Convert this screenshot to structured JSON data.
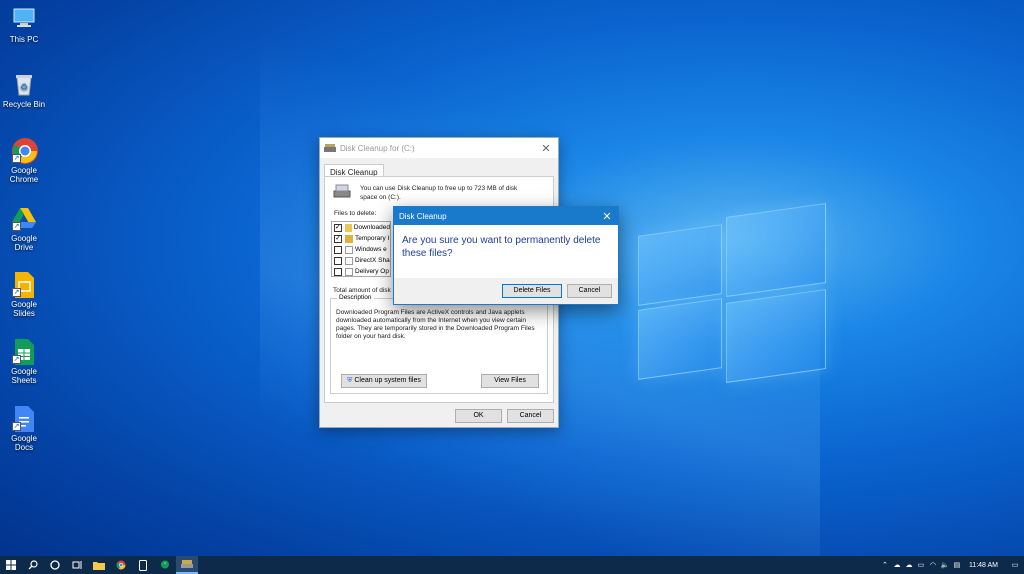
{
  "desktop": {
    "icons": [
      {
        "label": "This PC",
        "icon": "pc-icon"
      },
      {
        "label": "Recycle Bin",
        "icon": "recycle-bin-icon"
      },
      {
        "label": "Google Chrome",
        "icon": "chrome-icon"
      },
      {
        "label": "Google Drive",
        "icon": "google-drive-icon"
      },
      {
        "label": "Google Slides",
        "icon": "google-slides-icon"
      },
      {
        "label": "Google Sheets",
        "icon": "google-sheets-icon"
      },
      {
        "label": "Google Docs",
        "icon": "google-docs-icon"
      }
    ]
  },
  "cleanup_window": {
    "title": "Disk Cleanup for  (C:)",
    "tab": "Disk Cleanup",
    "intro": "You can use Disk Cleanup to free up to 723 MB of disk space on  (C:).",
    "files_label": "Files to delete:",
    "files": [
      {
        "name": "Downloaded",
        "checked": true
      },
      {
        "name": "Temporary I",
        "checked": true
      },
      {
        "name": "Windows e",
        "checked": false
      },
      {
        "name": "DirectX Sha",
        "checked": false
      },
      {
        "name": "Delivery Op",
        "checked": false
      }
    ],
    "total_label": "Total amount of disk",
    "description_label": "Description",
    "description": "Downloaded Program Files are ActiveX controls and Java applets downloaded automatically from the Internet when you view certain pages. They are temporarily stored in the Downloaded Program Files folder on your hard disk.",
    "clean_system_button": "Clean up system files",
    "view_files_button": "View Files",
    "ok_button": "OK",
    "cancel_button": "Cancel"
  },
  "confirm_dialog": {
    "title": "Disk Cleanup",
    "message": "Are you sure you want to permanently delete these files?",
    "delete_button": "Delete Files",
    "cancel_button": "Cancel"
  },
  "taskbar": {
    "time": "11:48 AM"
  },
  "colors": {
    "dialog_accent": "#1979ca",
    "message_text": "#1e3f9a",
    "taskbar": "#0e2a4a"
  }
}
